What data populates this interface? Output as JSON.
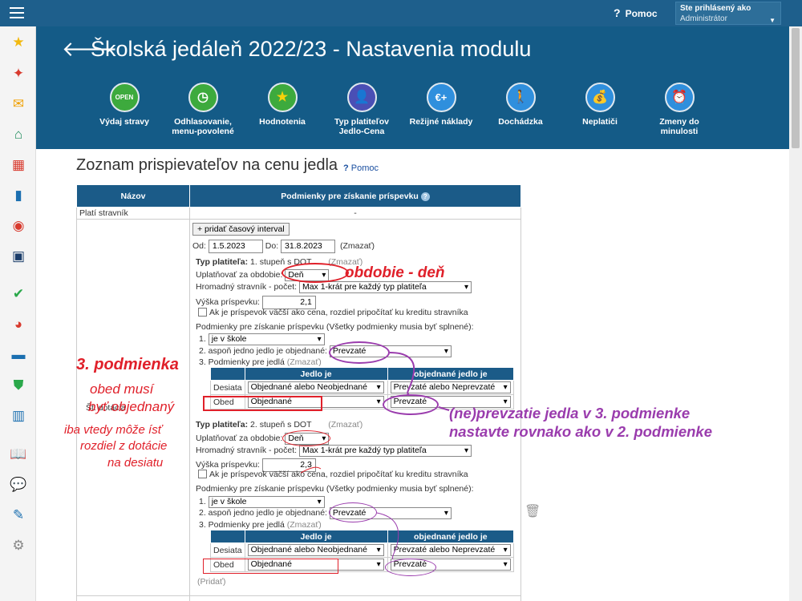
{
  "topbar": {
    "help_label": "Pomoc",
    "user_label": "Ste prihlásený ako",
    "user_name": "Administrátor"
  },
  "header": {
    "title": "Školská jedáleň 2022/23 - Nastavenia modulu"
  },
  "modules": [
    {
      "label": "Výdaj stravy",
      "color": "#3daa3d",
      "icon": "open-sign-icon",
      "glyph": "OPEN"
    },
    {
      "label": "Odhlasovanie, menu-povolené",
      "color": "#3daa3d",
      "icon": "clock-icon",
      "glyph": "◷"
    },
    {
      "label": "Hodnotenia",
      "color": "#3daa3d",
      "icon": "star-icon",
      "glyph": "★"
    },
    {
      "label": "Typ platiteľov Jedlo-Cena",
      "color": "#4a4fb5",
      "icon": "person-money-icon",
      "glyph": "👤"
    },
    {
      "label": "Režijné náklady",
      "color": "#2f8fdd",
      "icon": "euro-plus-icon",
      "glyph": "€+"
    },
    {
      "label": "Dochádzka",
      "color": "#2f8fdd",
      "icon": "walking-person-icon",
      "glyph": "🚶"
    },
    {
      "label": "Neplatiči",
      "color": "#2f8fdd",
      "icon": "money-bag-icon",
      "glyph": "💰"
    },
    {
      "label": "Zmeny do minulosti",
      "color": "#2f8fdd",
      "icon": "history-clock-icon",
      "glyph": "⏰"
    }
  ],
  "section": {
    "title": "Zoznam prispievateľov na cenu jedla",
    "help": "Pomoc"
  },
  "table": {
    "headers": [
      "Názov",
      "Podmienky pre získanie príspevku"
    ],
    "row1": {
      "name": "Platí stravník",
      "value": "-"
    },
    "row2": {
      "name": "Št. dotácia"
    }
  },
  "form": {
    "add_interval": "+ pridať časový interval",
    "od_label": "Od:",
    "od_value": "1.5.2023",
    "do_label": "Do:",
    "do_value": "31.8.2023",
    "delete": "(Zmazať)",
    "blocks": [
      {
        "typ_label": "Typ platiteľa:",
        "typ_value": "1. stupeň s DOT",
        "zmazat": "(Zmazať)",
        "uplatnovat_label": "Uplatňovať za obdobie:",
        "uplatnovat_value": "Deň",
        "hromadny_label": "Hromadný stravník - počet:",
        "hromadny_value": "Max 1-krát pre každý typ platiteľa",
        "vyska_label": "Výška príspevku:",
        "vyska_value": "2,1",
        "kredit_label": "Ak je príspevok väčší ako cena, rozdiel pripočítať ku kreditu stravníka",
        "podmienky_label": "Podmienky pre získanie príspevku (Všetky podmienky musia byť splnené):",
        "c1_label": "1.",
        "c1_value": "je v škole",
        "c2_label": "2. aspoň jedno jedlo je objednané:",
        "c2_value": "Prevzaté",
        "c3_label": "3. Podmienky pre jedlá",
        "c3_zmazat": "(Zmazať)",
        "ct_headers": [
          "",
          "Jedlo je",
          "objednané jedlo je"
        ],
        "ct_rows": [
          [
            "Desiata",
            "Objednané alebo Neobjednané",
            "Prevzaté alebo Neprevzaté"
          ],
          [
            "Obed",
            "Objednané",
            "Prevzaté"
          ]
        ]
      },
      {
        "typ_label": "Typ platiteľa:",
        "typ_value": "2. stupeň s DOT",
        "zmazat": "(Zmazať)",
        "uplatnovat_label": "Uplatňovať za obdobie:",
        "uplatnovat_value": "Deň",
        "hromadny_label": "Hromadný stravník - počet:",
        "hromadny_value": "Max 1-krát pre každý typ platiteľa",
        "vyska_label": "Výška príspevku:",
        "vyska_value": "2,3",
        "kredit_label": "Ak je príspevok väčší ako cena, rozdiel pripočítať ku kreditu stravníka",
        "podmienky_label": "Podmienky pre získanie príspevku (Všetky podmienky musia byť splnené):",
        "c1_label": "1.",
        "c1_value": "je v škole",
        "c2_label": "2. aspoň jedno jedlo je objednané:",
        "c2_value": "Prevzaté",
        "c3_label": "3. Podmienky pre jedlá",
        "c3_zmazat": "(Zmazať)",
        "ct_headers": [
          "",
          "Jedlo je",
          "objednané jedlo je"
        ],
        "ct_rows": [
          [
            "Desiata",
            "Objednané alebo Neobjednané",
            "Prevzaté alebo Neprevzaté"
          ],
          [
            "Obed",
            "Objednané",
            "Prevzaté"
          ]
        ]
      }
    ],
    "pridat": "(Pridať)"
  },
  "annotations": {
    "obdobie": "obdobie - deň",
    "podmienka_title": "3. podmienka",
    "obed1": "obed musí",
    "obed2": "byť objednaný",
    "iba1": "iba vtedy môže ísť",
    "iba2": "rozdiel z dotácie",
    "iba3": "na desiatu",
    "prevzatie1": "(ne)prevzatie jedla v 3. podmienke",
    "prevzatie2": "nastavte rovnako ako v 2. podmienke"
  },
  "colors": {
    "header_bg": "#145b87",
    "topbar_bg": "#1e5f8c",
    "annotation_red": "#e0202a",
    "annotation_purple": "#9a3cad"
  }
}
